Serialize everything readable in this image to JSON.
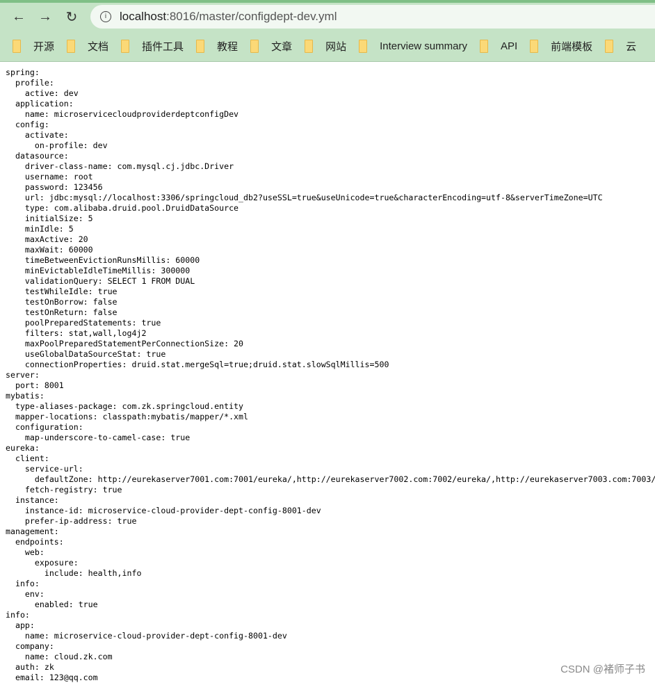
{
  "browser": {
    "url_host": "localhost",
    "url_path": ":8016/master/configdept-dev.yml",
    "bookmarks": [
      "开源",
      "文档",
      "插件工具",
      "教程",
      "文章",
      "网站",
      "Interview summary",
      "API",
      "前端模板",
      "云"
    ]
  },
  "yaml_lines": [
    "spring:",
    "  profile:",
    "    active: dev",
    "  application:",
    "    name: microservicecloudproviderdeptconfigDev",
    "  config:",
    "    activate:",
    "      on-profile: dev",
    "  datasource:",
    "    driver-class-name: com.mysql.cj.jdbc.Driver",
    "    username: root",
    "    password: 123456",
    "    url: jdbc:mysql://localhost:3306/springcloud_db2?useSSL=true&useUnicode=true&characterEncoding=utf-8&serverTimeZone=UTC",
    "    type: com.alibaba.druid.pool.DruidDataSource",
    "    initialSize: 5",
    "    minIdle: 5",
    "    maxActive: 20",
    "    maxWait: 60000",
    "    timeBetweenEvictionRunsMillis: 60000",
    "    minEvictableIdleTimeMillis: 300000",
    "    validationQuery: SELECT 1 FROM DUAL",
    "    testWhileIdle: true",
    "    testOnBorrow: false",
    "    testOnReturn: false",
    "    poolPreparedStatements: true",
    "    filters: stat,wall,log4j2",
    "    maxPoolPreparedStatementPerConnectionSize: 20",
    "    useGlobalDataSourceStat: true",
    "    connectionProperties: druid.stat.mergeSql=true;druid.stat.slowSqlMillis=500",
    "server:",
    "  port: 8001",
    "mybatis:",
    "  type-aliases-package: com.zk.springcloud.entity",
    "  mapper-locations: classpath:mybatis/mapper/*.xml",
    "  configuration:",
    "    map-underscore-to-camel-case: true",
    "eureka:",
    "  client:",
    "    service-url:",
    "      defaultZone: http://eurekaserver7001.com:7001/eureka/,http://eurekaserver7002.com:7002/eureka/,http://eurekaserver7003.com:7003/",
    "    fetch-registry: true",
    "  instance:",
    "    instance-id: microservice-cloud-provider-dept-config-8001-dev",
    "    prefer-ip-address: true",
    "management:",
    "  endpoints:",
    "    web:",
    "      exposure:",
    "        include: health,info",
    "  info:",
    "    env:",
    "      enabled: true",
    "info:",
    "  app:",
    "    name: microservice-cloud-provider-dept-config-8001-dev",
    "  company:",
    "    name: cloud.zk.com",
    "  auth: zk",
    "  email: 123@qq.com"
  ],
  "watermark": "CSDN @褚师子书"
}
